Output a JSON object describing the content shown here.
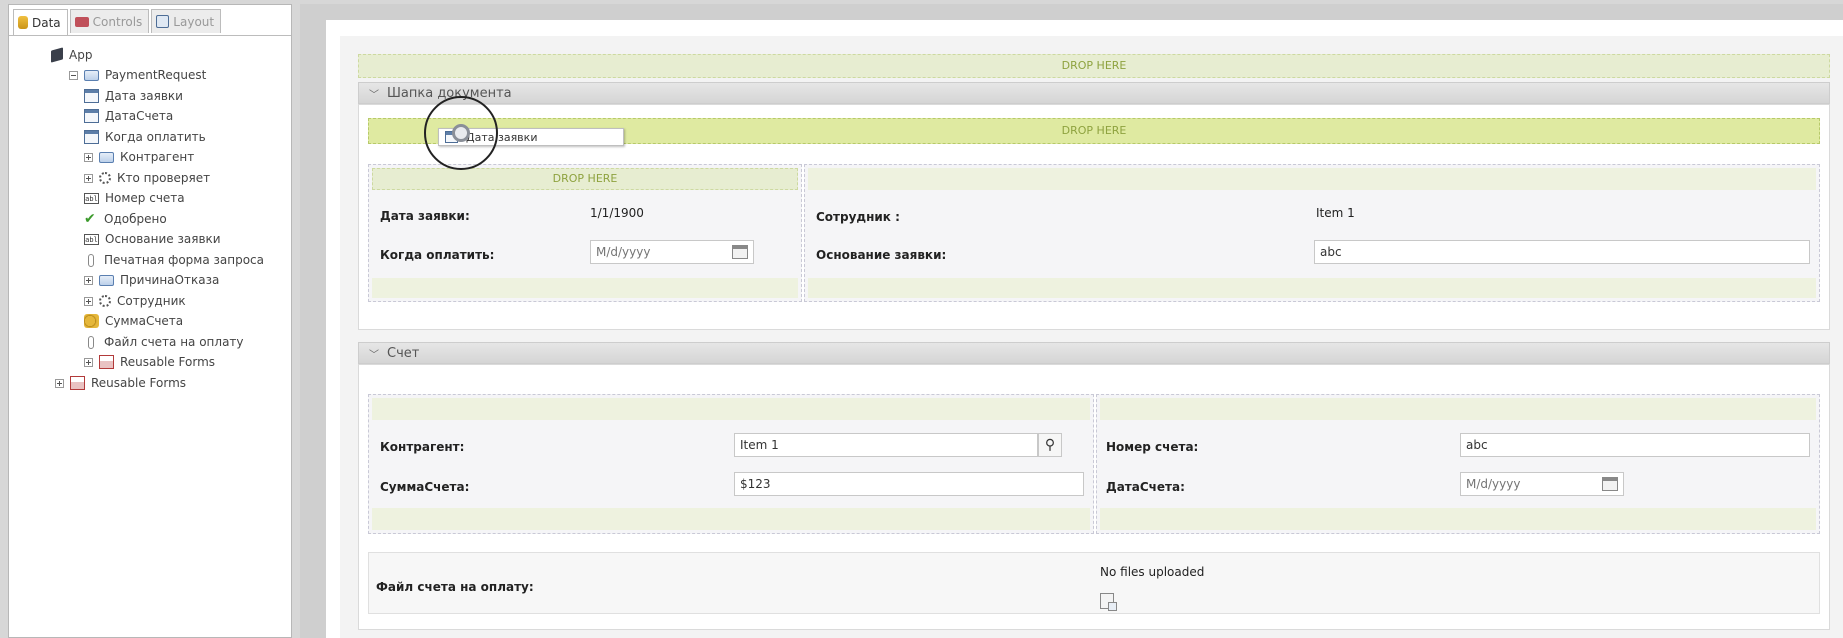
{
  "left_panel": {
    "tabs": [
      {
        "label": "Data",
        "active": true
      },
      {
        "label": "Controls",
        "active": false
      },
      {
        "label": "Layout",
        "active": false
      }
    ],
    "tree": [
      {
        "label": "App",
        "icon": "app-icon"
      },
      {
        "label": "PaymentRequest",
        "icon": "folder-icon",
        "expander": "minus"
      },
      {
        "label": "Дата заявки",
        "icon": "calendar-icon"
      },
      {
        "label": "ДатаСчета",
        "icon": "calendar-icon"
      },
      {
        "label": "Когда оплатить",
        "icon": "calendar-icon"
      },
      {
        "label": "Контрагент",
        "icon": "folder-icon",
        "expander": "plus"
      },
      {
        "label": "Кто проверяет",
        "icon": "gear-icon",
        "expander": "plus"
      },
      {
        "label": "Номер счета",
        "icon": "text-field-icon"
      },
      {
        "label": "Одобрено",
        "icon": "checkmark-icon"
      },
      {
        "label": "Основание заявки",
        "icon": "text-field-icon"
      },
      {
        "label": "Печатная форма запроса",
        "icon": "paperclip-icon"
      },
      {
        "label": "ПричинаОтказа",
        "icon": "folder-icon",
        "expander": "plus"
      },
      {
        "label": "Сотрудник",
        "icon": "gear-icon",
        "expander": "plus"
      },
      {
        "label": "СуммаСчета",
        "icon": "money-icon"
      },
      {
        "label": "Файл счета на оплату",
        "icon": "paperclip-icon"
      },
      {
        "label": "Reusable Forms",
        "icon": "forms-icon",
        "expander": "plus"
      },
      {
        "label": "Reusable Forms",
        "icon": "forms-icon",
        "expander": "plus"
      }
    ]
  },
  "canvas": {
    "drop_label": "DROP HERE",
    "drag_ghost_label": "Дата заявки",
    "section1": {
      "title": "Шапка документа",
      "left": {
        "row1_label": "Дата заявки:",
        "row1_value": "1/1/1900",
        "row2_label": "Когда оплатить:",
        "row2_placeholder": "M/d/yyyy"
      },
      "right": {
        "row1_label": "Сотрудник :",
        "row1_value": "Item 1",
        "row2_label": "Основание заявки:",
        "row2_value": "abc"
      }
    },
    "section2": {
      "title": "Счет",
      "left": {
        "row1_label": "Контрагент:",
        "row1_value": "Item 1",
        "row2_label": "СуммаСчета:",
        "row2_value": "$123"
      },
      "right": {
        "row1_label": "Номер счета:",
        "row1_value": "abc",
        "row2_label": "ДатаСчета:",
        "row2_placeholder": "M/d/yyyy"
      },
      "file_label": "Файл счета на оплату:",
      "file_status": "No files uploaded"
    }
  }
}
